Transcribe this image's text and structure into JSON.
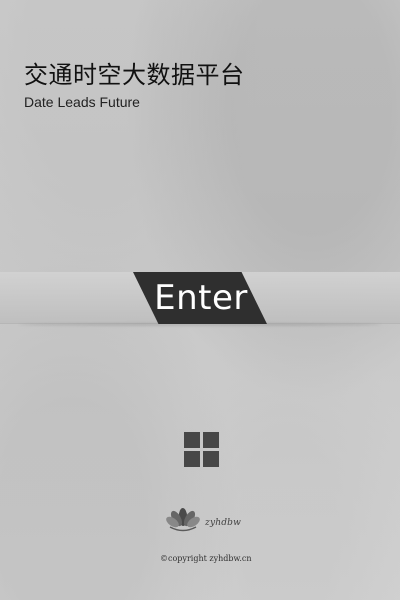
{
  "header": {
    "title": "交通时空大数据平台",
    "subtitle": "Date Leads Future"
  },
  "actions": {
    "enter_label": "Enter"
  },
  "icons": {
    "menu": "grid-menu-icon",
    "brand_mark": "lotus-logo-icon"
  },
  "brand": {
    "name": "zyhdbw"
  },
  "footer": {
    "copyright": "©copyright zyhdbw.cn"
  },
  "colors": {
    "background": "#cfcfcf",
    "enter_button": "#2f2f2f",
    "title_text": "#111111",
    "icon": "#474747"
  }
}
